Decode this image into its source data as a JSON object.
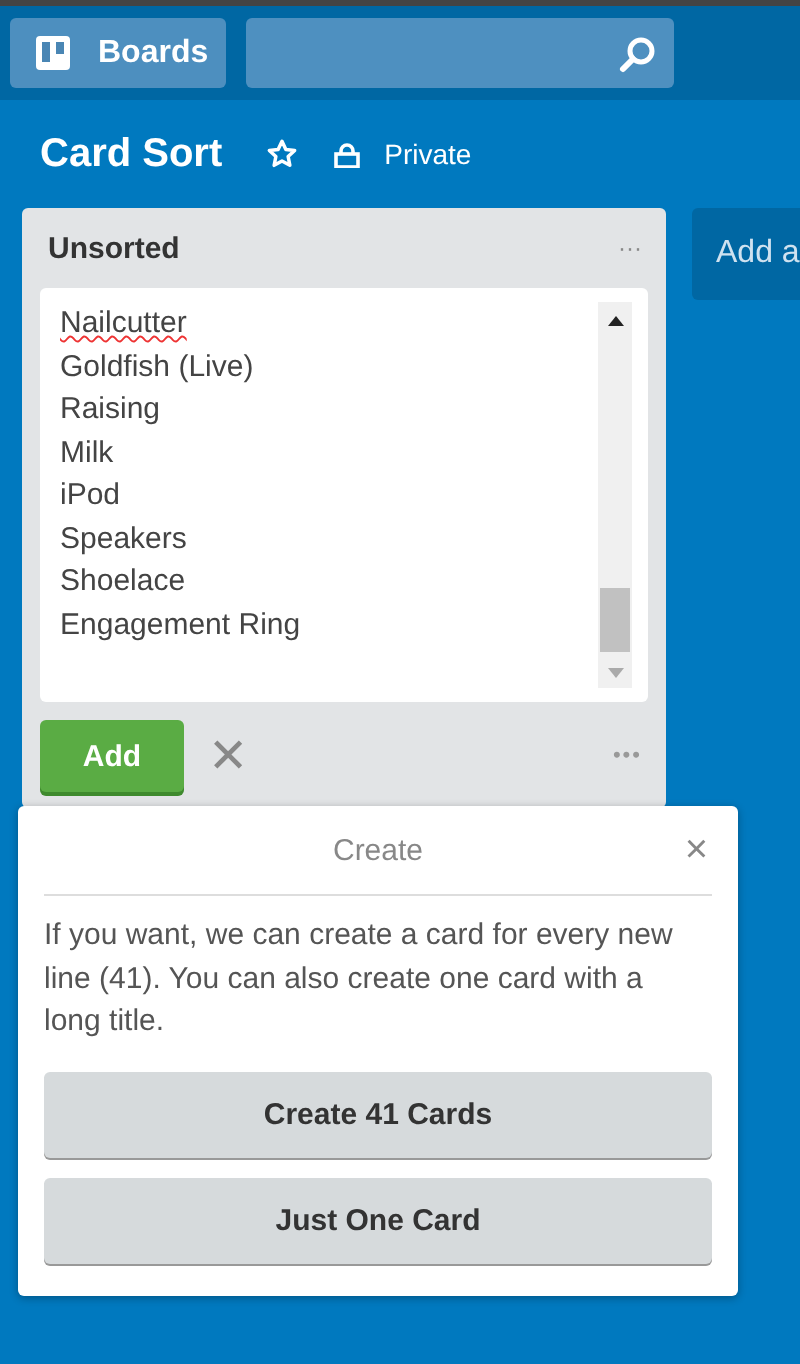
{
  "header": {
    "boards_button": "Boards"
  },
  "board": {
    "title": "Card Sort",
    "starred": false,
    "visibility": "Private"
  },
  "list": {
    "title": "Unsorted",
    "menu": "···",
    "card_input": {
      "lines": [
        {
          "text": "Nailcutter",
          "misspelled": true
        },
        {
          "text": "Goldfish (Live)",
          "misspelled": false
        },
        {
          "text": "Raising",
          "misspelled": false
        },
        {
          "text": "Milk",
          "misspelled": false
        },
        {
          "text": "iPod",
          "misspelled": false
        },
        {
          "text": "Speakers",
          "misspelled": false
        },
        {
          "text": "Shoelace",
          "misspelled": false
        },
        {
          "text": "Engagement Ring",
          "misspelled": false
        }
      ]
    },
    "add_button": "Add",
    "close": "✕",
    "more": "•••"
  },
  "add_list": "Add a",
  "popover": {
    "title": "Create",
    "close": "×",
    "message": "If you want, we can create a card for every new line (41). You can also create one card with a long title.",
    "buttons": [
      "Create 41 Cards",
      "Just One Card"
    ]
  }
}
